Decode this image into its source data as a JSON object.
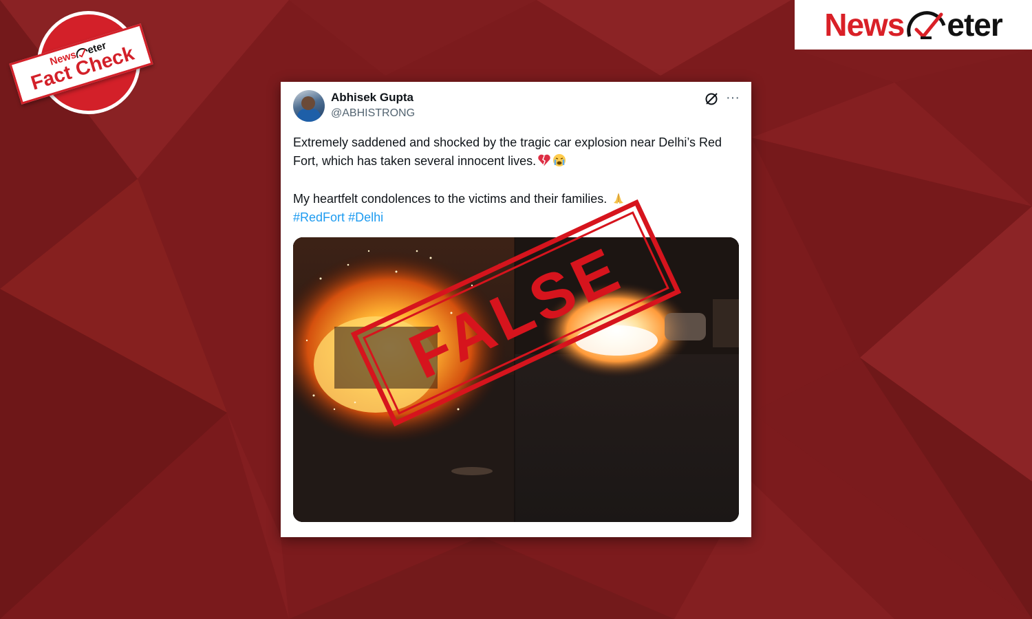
{
  "brand": {
    "name_part1": "News",
    "name_part2": "eter"
  },
  "badge": {
    "top_part1": "News",
    "top_part2": "eter",
    "main": "Fact Check"
  },
  "tweet": {
    "author_name": "Abhisek Gupta",
    "author_handle": "@ABHISTRONG",
    "text_line1": "Extremely saddened and shocked by the tragic car explosion near Delhi’s Red Fort, which has taken several innocent lives.",
    "text_line2": "My heartfelt condolences to the victims and their families.",
    "hashtags": [
      "#RedFort",
      "#Delhi"
    ],
    "media_alt": ""
  },
  "stamp": {
    "label": "FALSE"
  },
  "colors": {
    "brand_red": "#d92027",
    "background": "#7e1c1e",
    "link": "#1d9bf0",
    "stamp": "#d6141d"
  },
  "icons": [
    "grok-icon",
    "more-icon",
    "broken-heart-emoji",
    "crying-face-emoji",
    "folded-hands-emoji",
    "meter-icon"
  ]
}
